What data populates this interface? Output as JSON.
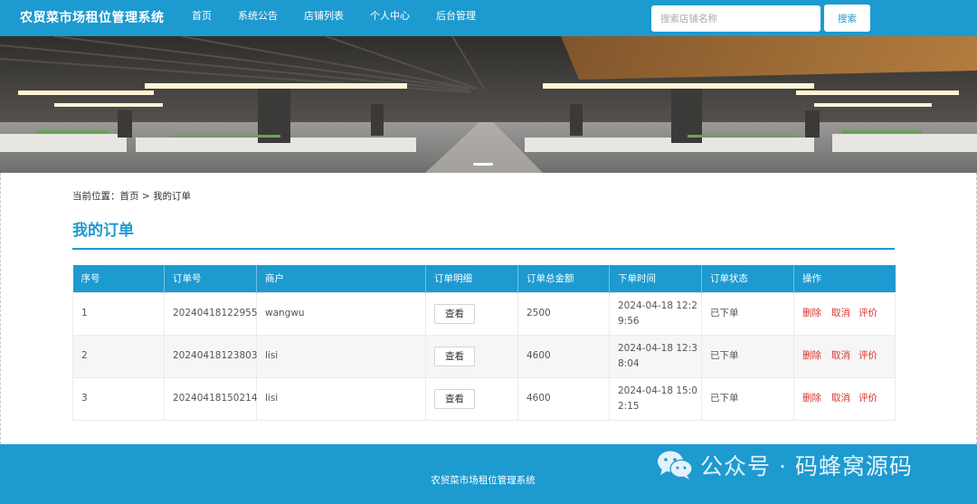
{
  "header": {
    "brand": "农贸菜市场租位管理系统",
    "nav": [
      "首页",
      "系统公告",
      "店铺列表",
      "个人中心",
      "后台管理"
    ],
    "search_placeholder": "搜索店铺名称",
    "search_button": "搜索"
  },
  "breadcrumb": "当前位置：首页 > 我的订单",
  "page_title": "我的订单",
  "table": {
    "columns": [
      "序号",
      "订单号",
      "商户",
      "订单明细",
      "订单总金额",
      "下单时间",
      "订单状态",
      "操作"
    ],
    "rows": [
      {
        "index": "1",
        "order_no": "20240418122955",
        "merchant": "wangwu",
        "detail_button": "查看",
        "total": "2500",
        "time_line1": "2024-04-18 12:2",
        "time_line2": "9:56",
        "status": "已下单"
      },
      {
        "index": "2",
        "order_no": "20240418123803",
        "merchant": "lisi",
        "detail_button": "查看",
        "total": "4600",
        "time_line1": "2024-04-18 12:3",
        "time_line2": "8:04",
        "status": "已下单"
      },
      {
        "index": "3",
        "order_no": "20240418150214",
        "merchant": "lisi",
        "detail_button": "查看",
        "total": "4600",
        "time_line1": "2024-04-18 15:0",
        "time_line2": "2:15",
        "status": "已下单"
      }
    ],
    "actions": {
      "delete": "删除",
      "cancel": "取消",
      "review": "评价"
    }
  },
  "footer": {
    "text": "农贸菜市场租位管理系统",
    "watermark": "公众号 · 码蜂窝源码"
  },
  "colors": {
    "primary": "#1d9ad0",
    "action": "#d9322d"
  }
}
